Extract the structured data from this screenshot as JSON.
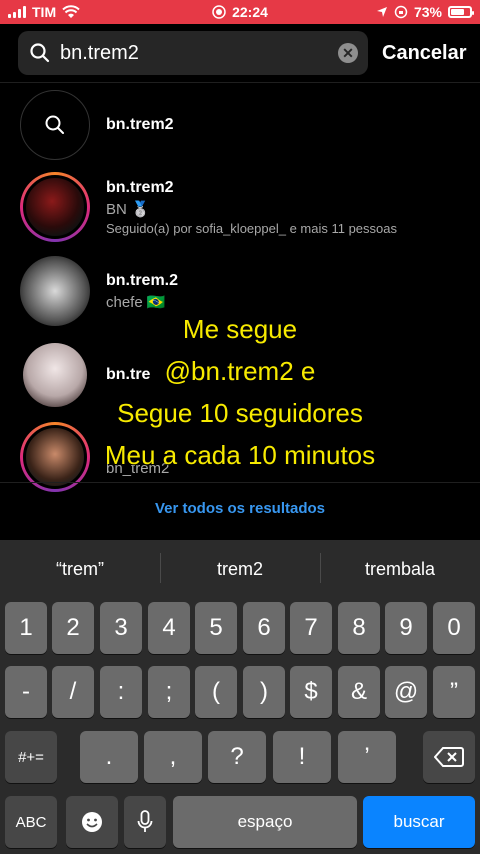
{
  "status_bar": {
    "carrier": "TIM",
    "time": "22:24",
    "battery": "73%",
    "battery_level": 0.73
  },
  "search": {
    "query": "bn.trem2",
    "cancel_label": "Cancelar"
  },
  "results": [
    {
      "type": "keyword",
      "username": "bn.trem2"
    },
    {
      "type": "account",
      "username": "bn.trem2",
      "subtitle": "BN 🥈",
      "followed_by": "Seguido(a) por sofia_kloeppel_ e mais 11 pessoas",
      "ring": true
    },
    {
      "type": "account",
      "username": "bn.trem.2",
      "subtitle": "chefe 🇧🇷",
      "ring": false
    },
    {
      "type": "account",
      "username": "bn.tre",
      "subtitle": "",
      "ring": false
    },
    {
      "type": "account",
      "username": "bn_trem2",
      "subtitle": "",
      "ring": true
    }
  ],
  "overlay_text": [
    "Me segue",
    "@bn.trem2 e",
    "Segue 10 seguidores",
    "Meu a cada 10 minutos"
  ],
  "see_all_label": "Ver todos os resultados",
  "keyboard": {
    "suggestions": [
      "“trem”",
      "trem2",
      "trembala"
    ],
    "row1": [
      "1",
      "2",
      "3",
      "4",
      "5",
      "6",
      "7",
      "8",
      "9",
      "0"
    ],
    "row2": [
      "-",
      "/",
      ":",
      ";",
      "(",
      ")",
      "$",
      "&",
      "@",
      "”"
    ],
    "row3_mode": "#+=",
    "row3": [
      ".",
      ",",
      "?",
      "!",
      "’"
    ],
    "abc_label": "ABC",
    "space_label": "espaço",
    "return_label": "buscar"
  },
  "colors": {
    "status_bar": "#e63946",
    "overlay_text": "#f7ea00",
    "link": "#3897f0",
    "return_key": "#0a84ff"
  }
}
